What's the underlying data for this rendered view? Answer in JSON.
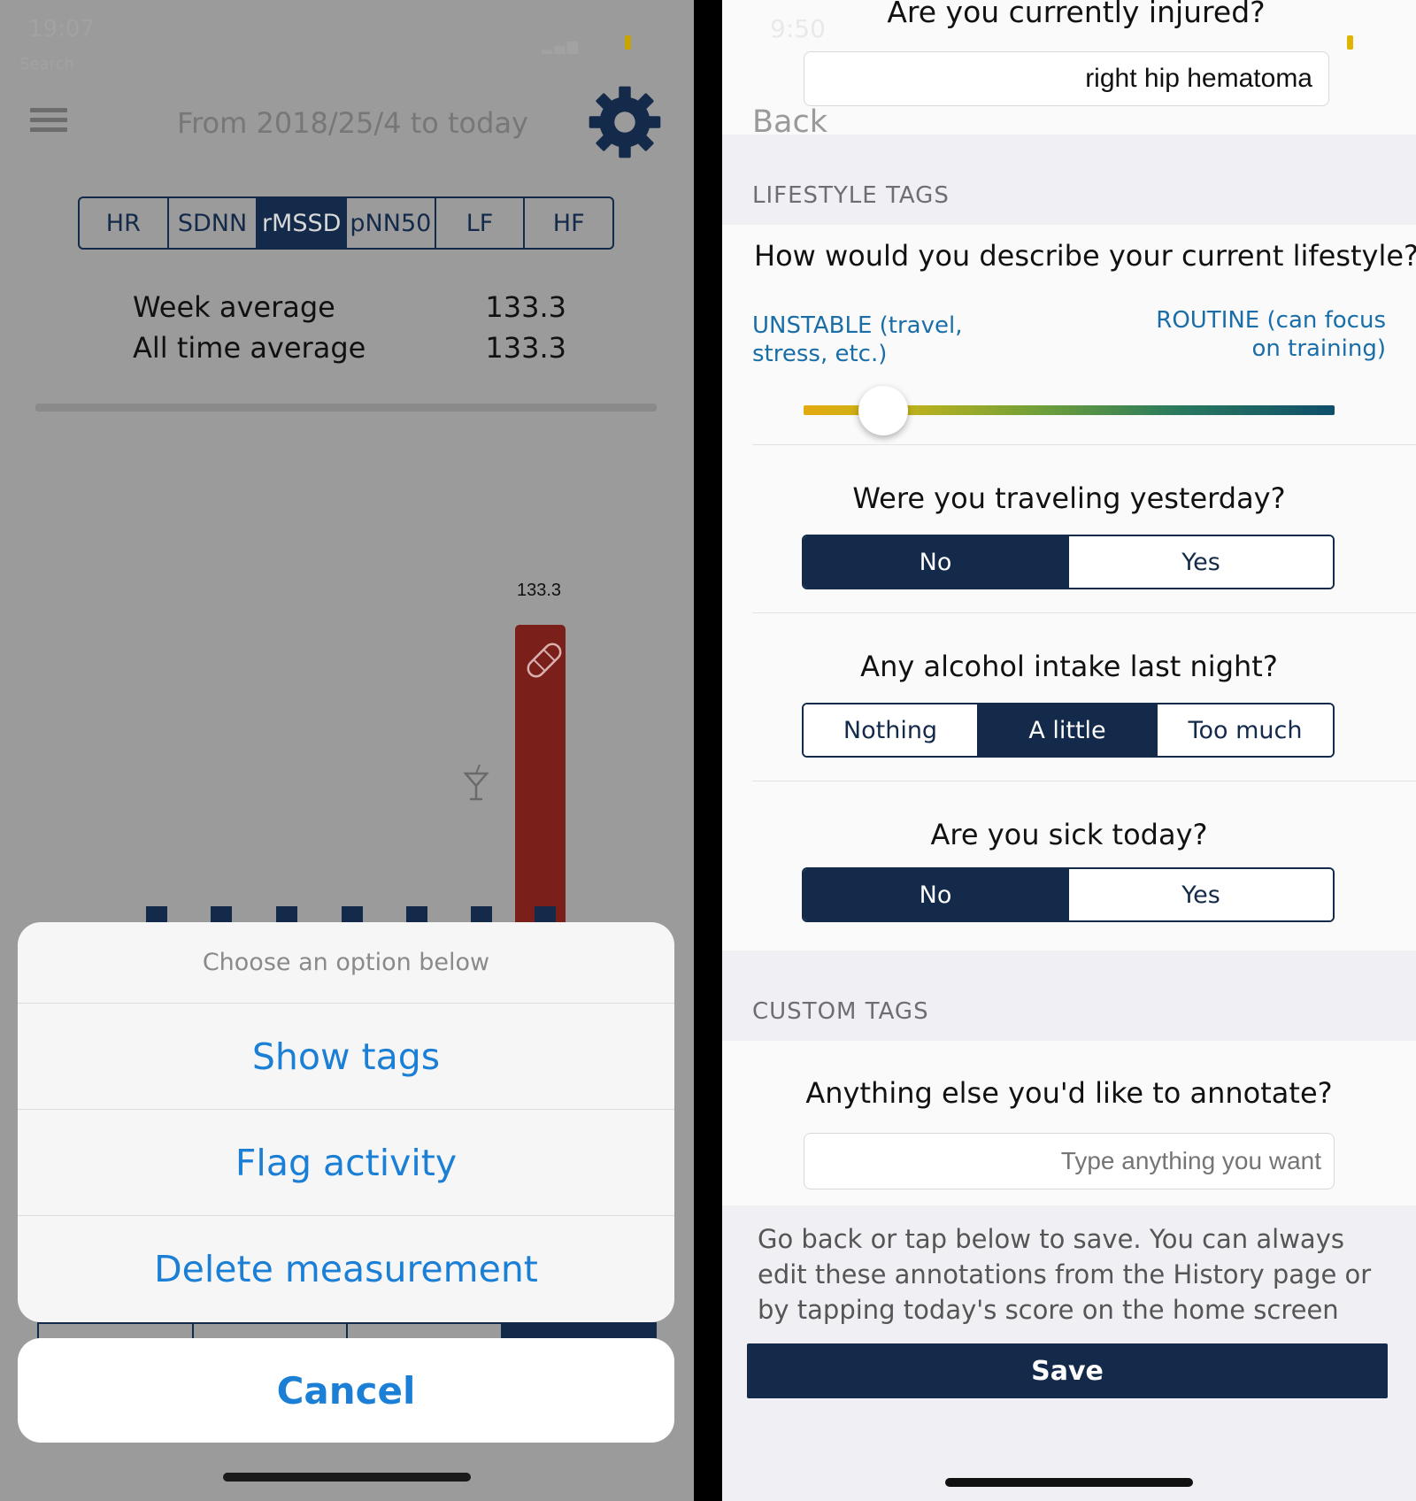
{
  "left": {
    "status": {
      "time": "19:07",
      "sub": "Search"
    },
    "header": {
      "date_range": "From 2018/25/4 to today"
    },
    "metric_tabs": [
      {
        "label": "HR",
        "active": false
      },
      {
        "label": "SDNN",
        "active": false
      },
      {
        "label": "rMSSD",
        "active": true
      },
      {
        "label": "pNN50",
        "active": false
      },
      {
        "label": "LF",
        "active": false
      },
      {
        "label": "HF",
        "active": false
      }
    ],
    "averages": {
      "week_label": "Week average",
      "week_value": "133.3",
      "all_label": "All time average",
      "all_value": "133.3"
    },
    "chart": {
      "highlight_value_label": "133.3",
      "highlight_color": "#7a1f1a",
      "bar_color": "#132a4a"
    },
    "action_sheet": {
      "title": "Choose an option below",
      "options": [
        "Show tags",
        "Flag activity",
        "Delete measurement"
      ],
      "cancel": "Cancel"
    }
  },
  "right": {
    "status": {
      "time": "9:50"
    },
    "injured": {
      "question": "Are you currently injured?",
      "value": "right hip hematoma"
    },
    "back": "Back",
    "lifestyle_header": "LIFESTYLE TAGS",
    "lifestyle": {
      "question": "How would you describe your current lifestyle?",
      "left_label": "UNSTABLE (travel, stress, etc.)",
      "right_label": "ROUTINE (can focus on training)",
      "level": 0.15
    },
    "travel": {
      "question": "Were you traveling yesterday?",
      "options": [
        "No",
        "Yes"
      ],
      "selected": 0
    },
    "alcohol": {
      "question": "Any alcohol intake last night?",
      "options": [
        "Nothing",
        "A little",
        "Too much"
      ],
      "selected": 1
    },
    "sick": {
      "question": "Are you sick today?",
      "options": [
        "No",
        "Yes"
      ],
      "selected": 0
    },
    "custom_header": "CUSTOM TAGS",
    "annotate": {
      "question": "Anything else you'd like to annotate?",
      "placeholder": "Type anything you want"
    },
    "footer_note": "Go back or tap below to save. You can always edit these annotations from the History page or by tapping today's score on the home screen",
    "save": "Save"
  }
}
